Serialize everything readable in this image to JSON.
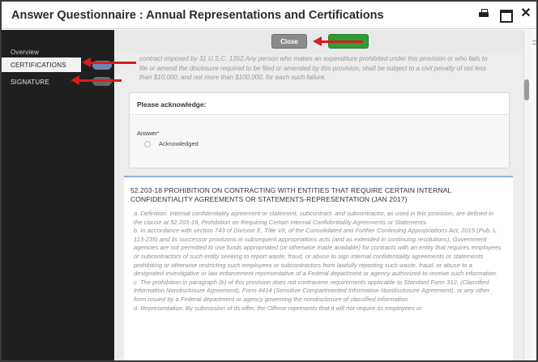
{
  "window": {
    "title": "Answer Questionnaire : Annual Representations and Certifications"
  },
  "sidebar": {
    "items": [
      {
        "label": "Overview"
      },
      {
        "label": "CERTIFICATIONS"
      },
      {
        "label": "SIGNATURE"
      }
    ]
  },
  "toolbar": {
    "close_label": "Close"
  },
  "content": {
    "intro_text": "contract imposed by 31 U.S.C. 1352.Any person who makes an expenditure prohibited under this provision or who fails to file or amend the disclosure required to be filed or amended by this provision, shall be subject to a civil penalty of not less than $10,000, and not more than $100,000, for each such failure.",
    "ack_heading": "Please acknowledge:",
    "answer_label": "Answer",
    "answer_required_mark": "*",
    "option_label": "Acknowledged",
    "clause_title": "52.203-18 PROHIBITION ON CONTRACTING WITH ENTITIES THAT REQUIRE CERTAIN INTERNAL CONFIDENTIALITY AGREEMENTS OR STATEMENTS-REPRESENTATION (JAN 2017)",
    "clause_paragraphs": [
      "a. Definition. Internal confidentiality agreement or statement, subcontract, and subcontractor, as used in this provision, are defined in the clause at 52.203-19, Prohibition on Requiring Certain Internal Confidentiality Agreements or Statements.",
      "b. In accordance with section 743 of Division E, Title VII, of the Consolidated and Further Continuing Appropriations Act, 2015 (Pub. L. 113-235) and its successor provisions in subsequent appropriations acts (and as extended in continuing resolutions), Government agencies are not permitted to use funds appropriated (or otherwise made available) for contracts with an entity that requires employees or subcontractors of such entity seeking to report waste, fraud, or abuse to sign internal confidentiality agreements or statements prohibiting or otherwise restricting such employees or subcontractors from lawfully reporting such waste, fraud, or abuse to a designated investigative or law enforcement representative of a Federal department or agency authorized to receive such information.",
      "c. The prohibition in paragraph (b) of this provision does not contravene requirements applicable to Standard Form 312, (Classified Information Nondisclosure Agreement), Form 4414 (Sensitive Compartmented Information Nondisclosure Agreement), or any other form issued by a Federal department or agency governing the nondisclosure of classified information.",
      "d. Representation. By submission of its offer, the Offeror represents that it will not require its employees or"
    ]
  },
  "colors": {
    "sidebar_bg": "#1f1f1f",
    "close_button": "#8b8b8b",
    "submit_button": "#2f9b35",
    "annotation_arrow": "#d51e1e"
  }
}
